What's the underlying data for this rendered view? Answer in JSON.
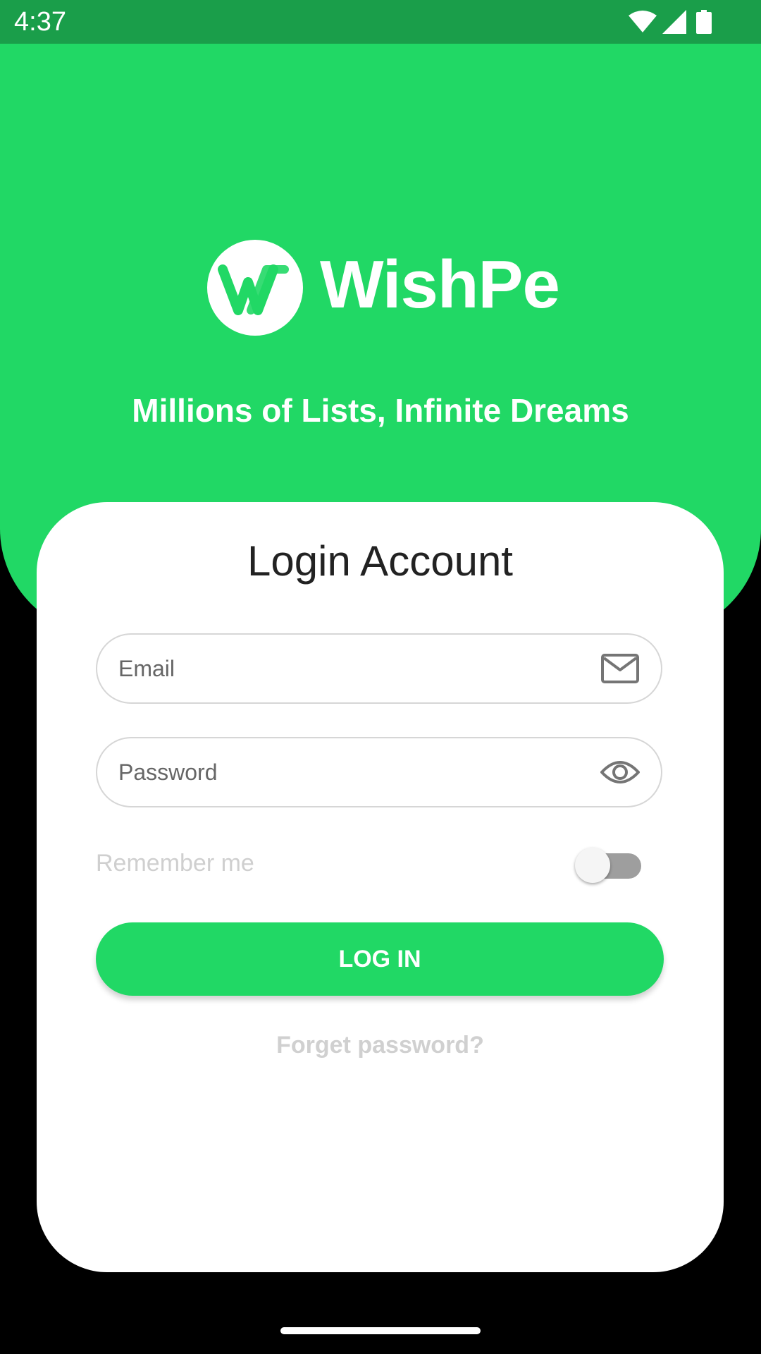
{
  "status_bar": {
    "time": "4:37",
    "icons": [
      "wifi-icon",
      "cellular-signal-icon",
      "battery-icon"
    ]
  },
  "brand": {
    "name": "WishPe",
    "tagline": "Millions of Lists, Infinite Dreams",
    "color": "#21d865",
    "status_bar_color": "#1a9e4a"
  },
  "login": {
    "title": "Login Account",
    "email": {
      "placeholder": "Email",
      "value": "",
      "icon": "envelope-icon"
    },
    "password": {
      "placeholder": "Password",
      "value": "",
      "icon": "eye-icon"
    },
    "remember_me": {
      "label": "Remember me",
      "checked": false
    },
    "submit_label": "LOG IN",
    "forgot_label": "Forget password?"
  }
}
